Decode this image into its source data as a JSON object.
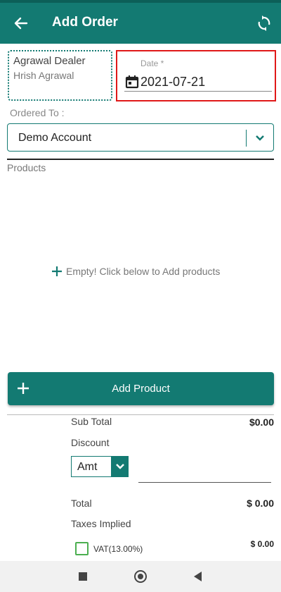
{
  "appbar": {
    "title": "Add Order",
    "back_icon": "arrow-left-icon",
    "sync_icon": "sync-icon"
  },
  "dealer": {
    "name": "Agrawal Dealer",
    "person": "Hrish Agrawal"
  },
  "date": {
    "label": "Date *",
    "value": "2021-07-21",
    "icon": "calendar-icon"
  },
  "ordered_to": {
    "label": "Ordered To :",
    "selected": "Demo Account"
  },
  "products": {
    "label": "Products",
    "empty_message": "Empty! Click below to Add products"
  },
  "add_button": {
    "label": "Add Product"
  },
  "summary": {
    "subtotal_label": "Sub Total",
    "subtotal_value": "$0.00",
    "discount_label": "Discount",
    "discount_type": "Amt",
    "total_label": "Total",
    "total_value": "$ 0.00",
    "taxes_label": "Taxes Implied",
    "vat_label": "VAT(13.00%)",
    "vat_value": "$ 0.00"
  },
  "colors": {
    "primary": "#137a72",
    "primary_dark": "#0c5f58",
    "highlight": "#e01818",
    "checkbox": "#4caf50"
  }
}
